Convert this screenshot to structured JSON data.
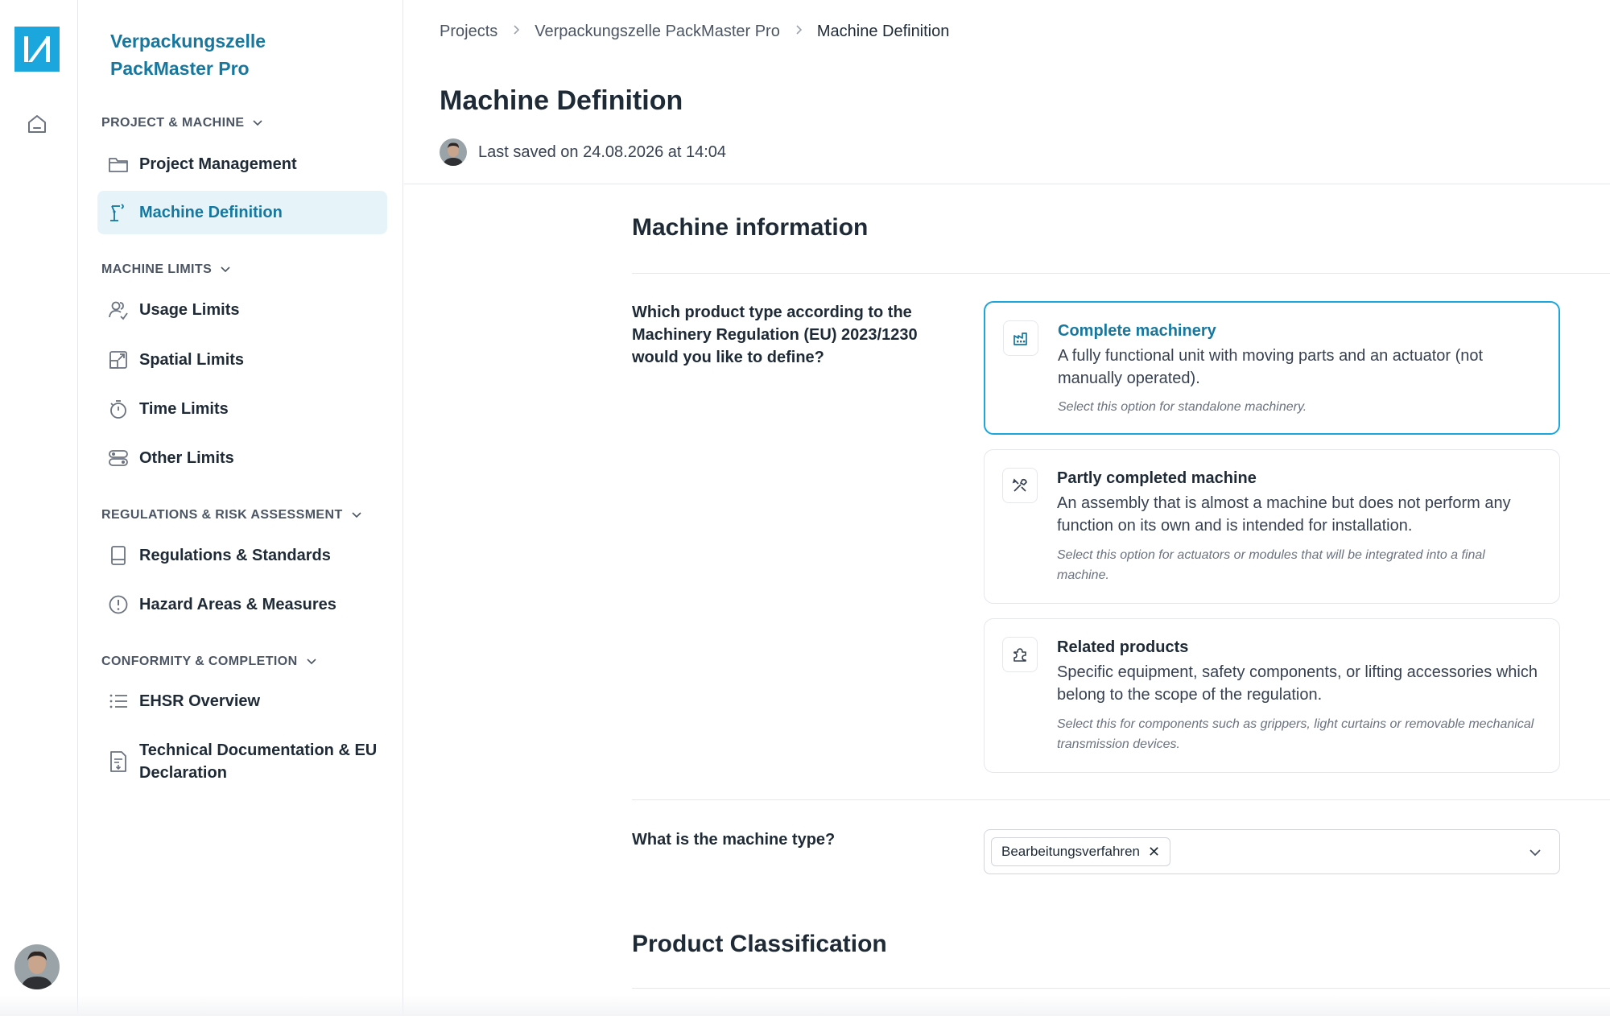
{
  "colors": {
    "accent": "#1ba6dd",
    "accent_text": "#16779f",
    "active_bg": "#e6f4fa"
  },
  "project": {
    "title": "Verpackungszelle PackMaster Pro"
  },
  "sidebar": {
    "sections": [
      {
        "heading": "PROJECT & MACHINE",
        "items": [
          {
            "label": "Project Management",
            "icon": "folder-icon"
          },
          {
            "label": "Machine Definition",
            "icon": "robot-arm-icon",
            "active": true
          }
        ]
      },
      {
        "heading": "MACHINE LIMITS",
        "items": [
          {
            "label": "Usage Limits",
            "icon": "users-icon"
          },
          {
            "label": "Spatial Limits",
            "icon": "expand-icon"
          },
          {
            "label": "Time Limits",
            "icon": "stopwatch-icon"
          },
          {
            "label": "Other Limits",
            "icon": "toggles-icon"
          }
        ]
      },
      {
        "heading": "REGULATIONS & RISK ASSESSMENT",
        "items": [
          {
            "label": "Regulations & Standards",
            "icon": "book-icon"
          },
          {
            "label": "Hazard Areas & Measures",
            "icon": "alert-circle-icon"
          }
        ]
      },
      {
        "heading": "CONFORMITY & COMPLETION",
        "items": [
          {
            "label": "EHSR Overview",
            "icon": "list-icon"
          },
          {
            "label": "Technical Documentation & EU Declaration",
            "icon": "document-download-icon"
          }
        ]
      }
    ]
  },
  "breadcrumb": {
    "items": [
      "Projects",
      "Verpackungszelle PackMaster Pro",
      "Machine Definition"
    ]
  },
  "page": {
    "title": "Machine Definition",
    "last_saved": "Last saved on 24.08.2026 at 14:04"
  },
  "machine_info": {
    "title": "Machine information",
    "question": "Which product type according to the Machinery Regulation (EU) 2023/1230 would you like to define?",
    "options": [
      {
        "title": "Complete machinery",
        "description": "A fully functional unit with moving parts and an actuator (not manually operated).",
        "hint": "Select this option for standalone machinery.",
        "icon": "factory-icon",
        "selected": true
      },
      {
        "title": "Partly completed machine",
        "description": "An assembly that is almost a machine but does not perform any function on its own and is intended for installation.",
        "hint": "Select this option for actuators or modules that will be integrated into a final machine.",
        "icon": "tools-icon",
        "selected": false
      },
      {
        "title": "Related products",
        "description": "Specific equipment, safety components, or lifting accessories which belong to the scope of the regulation.",
        "hint": "Select this for components such as grippers, light curtains or removable mechanical transmission devices.",
        "icon": "puzzle-icon",
        "selected": false
      }
    ],
    "machine_type_question": "What is the machine type?",
    "machine_type_selected": [
      "Bearbeitungsverfahren"
    ],
    "remove_symbol": "✕"
  },
  "classification": {
    "title": "Product Classification"
  }
}
